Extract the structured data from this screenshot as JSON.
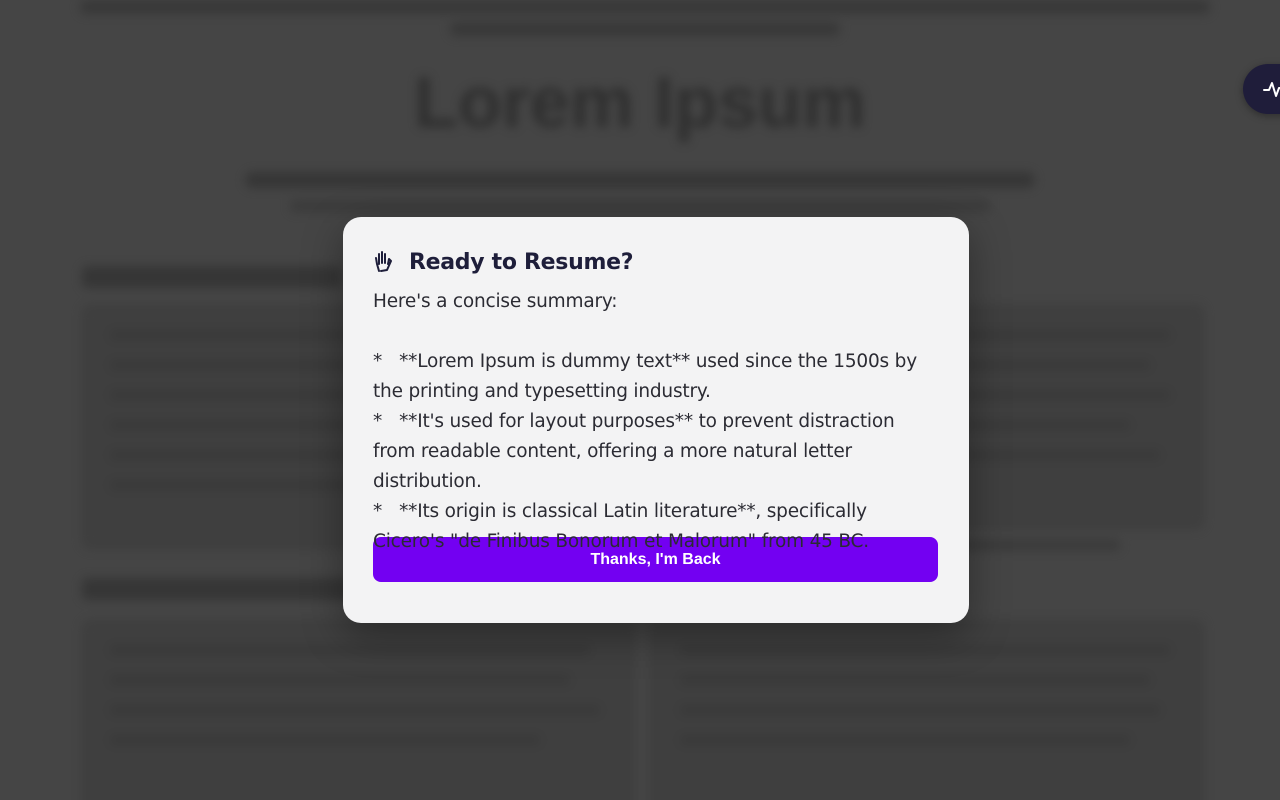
{
  "background": {
    "page_title": "Lorem Ipsum"
  },
  "floating_button": {
    "icon": "pulse-icon"
  },
  "modal": {
    "icon": "hand-icon",
    "title": "Ready to Resume?",
    "intro": "Here's a concise summary:",
    "bullets": [
      "*   **Lorem Ipsum is dummy text** used since the 1500s by the printing and typesetting industry.",
      "*   **It's used for layout purposes** to prevent distraction from readable content, offering a more natural letter distribution.",
      "*   **Its origin is classical Latin literature**, specifically Cicero's \"de Finibus Bonorum et Malorum\" from 45 BC."
    ],
    "button_label": "Thanks, I'm Back"
  },
  "colors": {
    "overlay": "#454545",
    "modal_bg": "#f3f3f4",
    "button_bg": "#7300f2",
    "title": "#1e1e3a"
  }
}
